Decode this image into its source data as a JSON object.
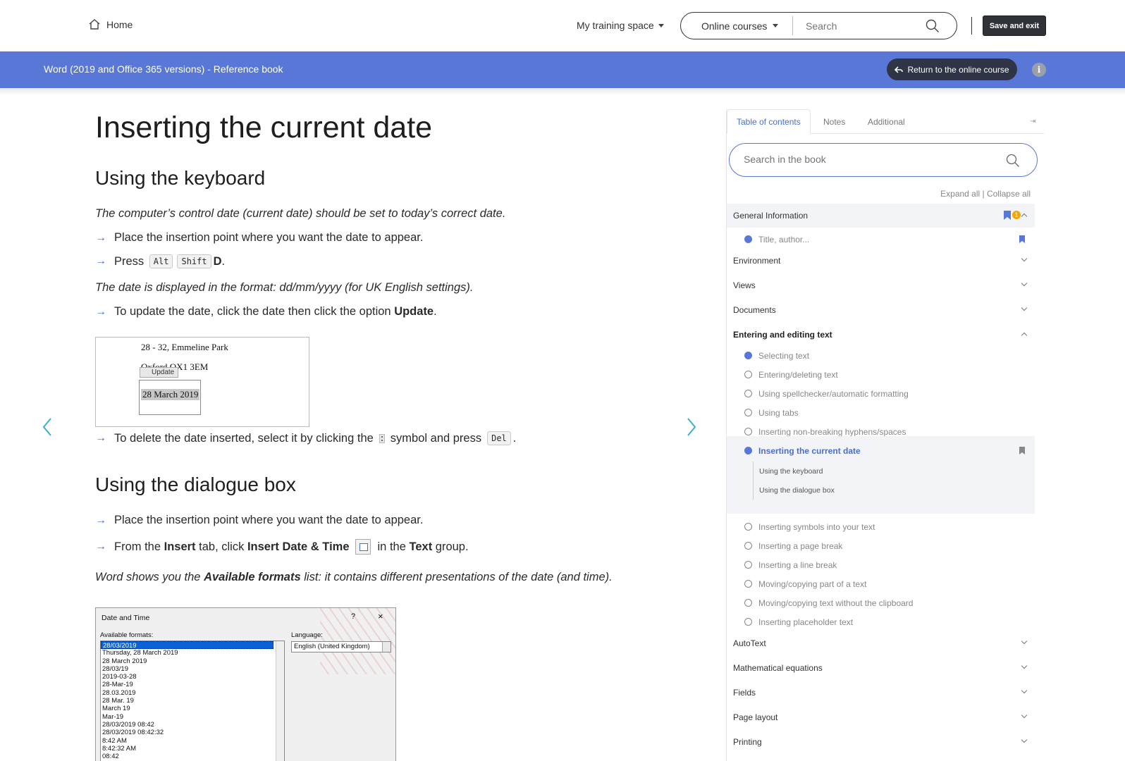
{
  "topnav": {
    "home_label": "Home",
    "training_label": "My training space",
    "courses_label": "Online courses",
    "search_placeholder": "Search",
    "save_exit_label": "Save and exit"
  },
  "banner": {
    "book_title": "Word (2019 and Office 365 versions) - Reference book",
    "return_label": "Return to the online course",
    "info_glyph": "i",
    "color": "#5877d6"
  },
  "content": {
    "page_title": "Inserting the current date",
    "section1_title": "Using the keyboard",
    "p1": "The computer’s control date (current date) should be set to today’s correct date.",
    "b1": "Place the insertion point where you want the date to appear.",
    "b2_text": "Press",
    "b2_key1": "Alt",
    "b2_key2": "Shift",
    "b2_key3": "D",
    "p2": "The date is displayed in the format: dd/mm/yyyy (for UK English settings).",
    "b3_text": "To update the date, click the date then click the option",
    "b3_bold": "Update",
    "shot1": {
      "address1": "28 - 32, Emmeline Park",
      "address2": "Oxford OX1 3EM",
      "update_label": "Update",
      "date_value": "28 March 2019"
    },
    "b4_text1": "To delete the date inserted, select it by clicking the",
    "b4_text2": "symbol and press",
    "b4_key": "Del",
    "section2_title": "Using the dialogue box",
    "b5": "Place the insertion point where you want the date to appear.",
    "b6_text1": "From the",
    "b6_bold1": "Insert",
    "b6_text2": "tab, click",
    "b6_bold2": "Insert Date & Time",
    "b6_text3": "in the",
    "b6_bold3": "Text",
    "b6_text4": "group.",
    "p3_text1": "Word shows you the",
    "p3_bold": "Available formats",
    "p3_text2": "list: it contains different presentations of the date (and time).",
    "shot2": {
      "title": "Date and Time",
      "help": "?",
      "close": "×",
      "formats_label": "Available formats:",
      "language_label": "Language:",
      "language_value": "English (United Kingdom)",
      "formats": [
        "28/03/2019",
        "Thursday, 28 March 2019",
        "28 March 2019",
        "28/03/19",
        "2019-03-28",
        "28-Mar-19",
        "28.03.2019",
        "28 Mar. 19",
        "March 19",
        "Mar-19",
        "28/03/2019 08:42",
        "28/03/2019 08:42:32",
        "8:42 AM",
        "8:42:32 AM",
        "08:42"
      ]
    }
  },
  "sidebar": {
    "tabs": [
      "Table of contents",
      "Notes",
      "Additional"
    ],
    "search_placeholder": "Search in the book",
    "expand_collapse": "Expand all | Collapse all",
    "bookmark_count": "1",
    "chapters": {
      "general": "General Information",
      "environment": "Environment",
      "views": "Views",
      "documents": "Documents",
      "entering": "Entering and editing text",
      "autotext": "AutoText",
      "math": "Mathematical equations",
      "fields": "Fields",
      "page_layout": "Page layout",
      "printing": "Printing"
    },
    "general_items": [
      "Title, author..."
    ],
    "entering_items": [
      "Selecting text",
      "Entering/deleting text",
      "Using spellchecker/automatic formatting",
      "Using tabs",
      "Inserting non-breaking hyphens/spaces",
      "Inserting the current date",
      "Inserting symbols into your text",
      "Inserting a page break",
      "Inserting a line break",
      "Moving/copying part of a text",
      "Moving/copying text without the clipboard",
      "Inserting placeholder text"
    ],
    "current_subsections": [
      "Using the keyboard",
      "Using the dialogue box"
    ]
  }
}
